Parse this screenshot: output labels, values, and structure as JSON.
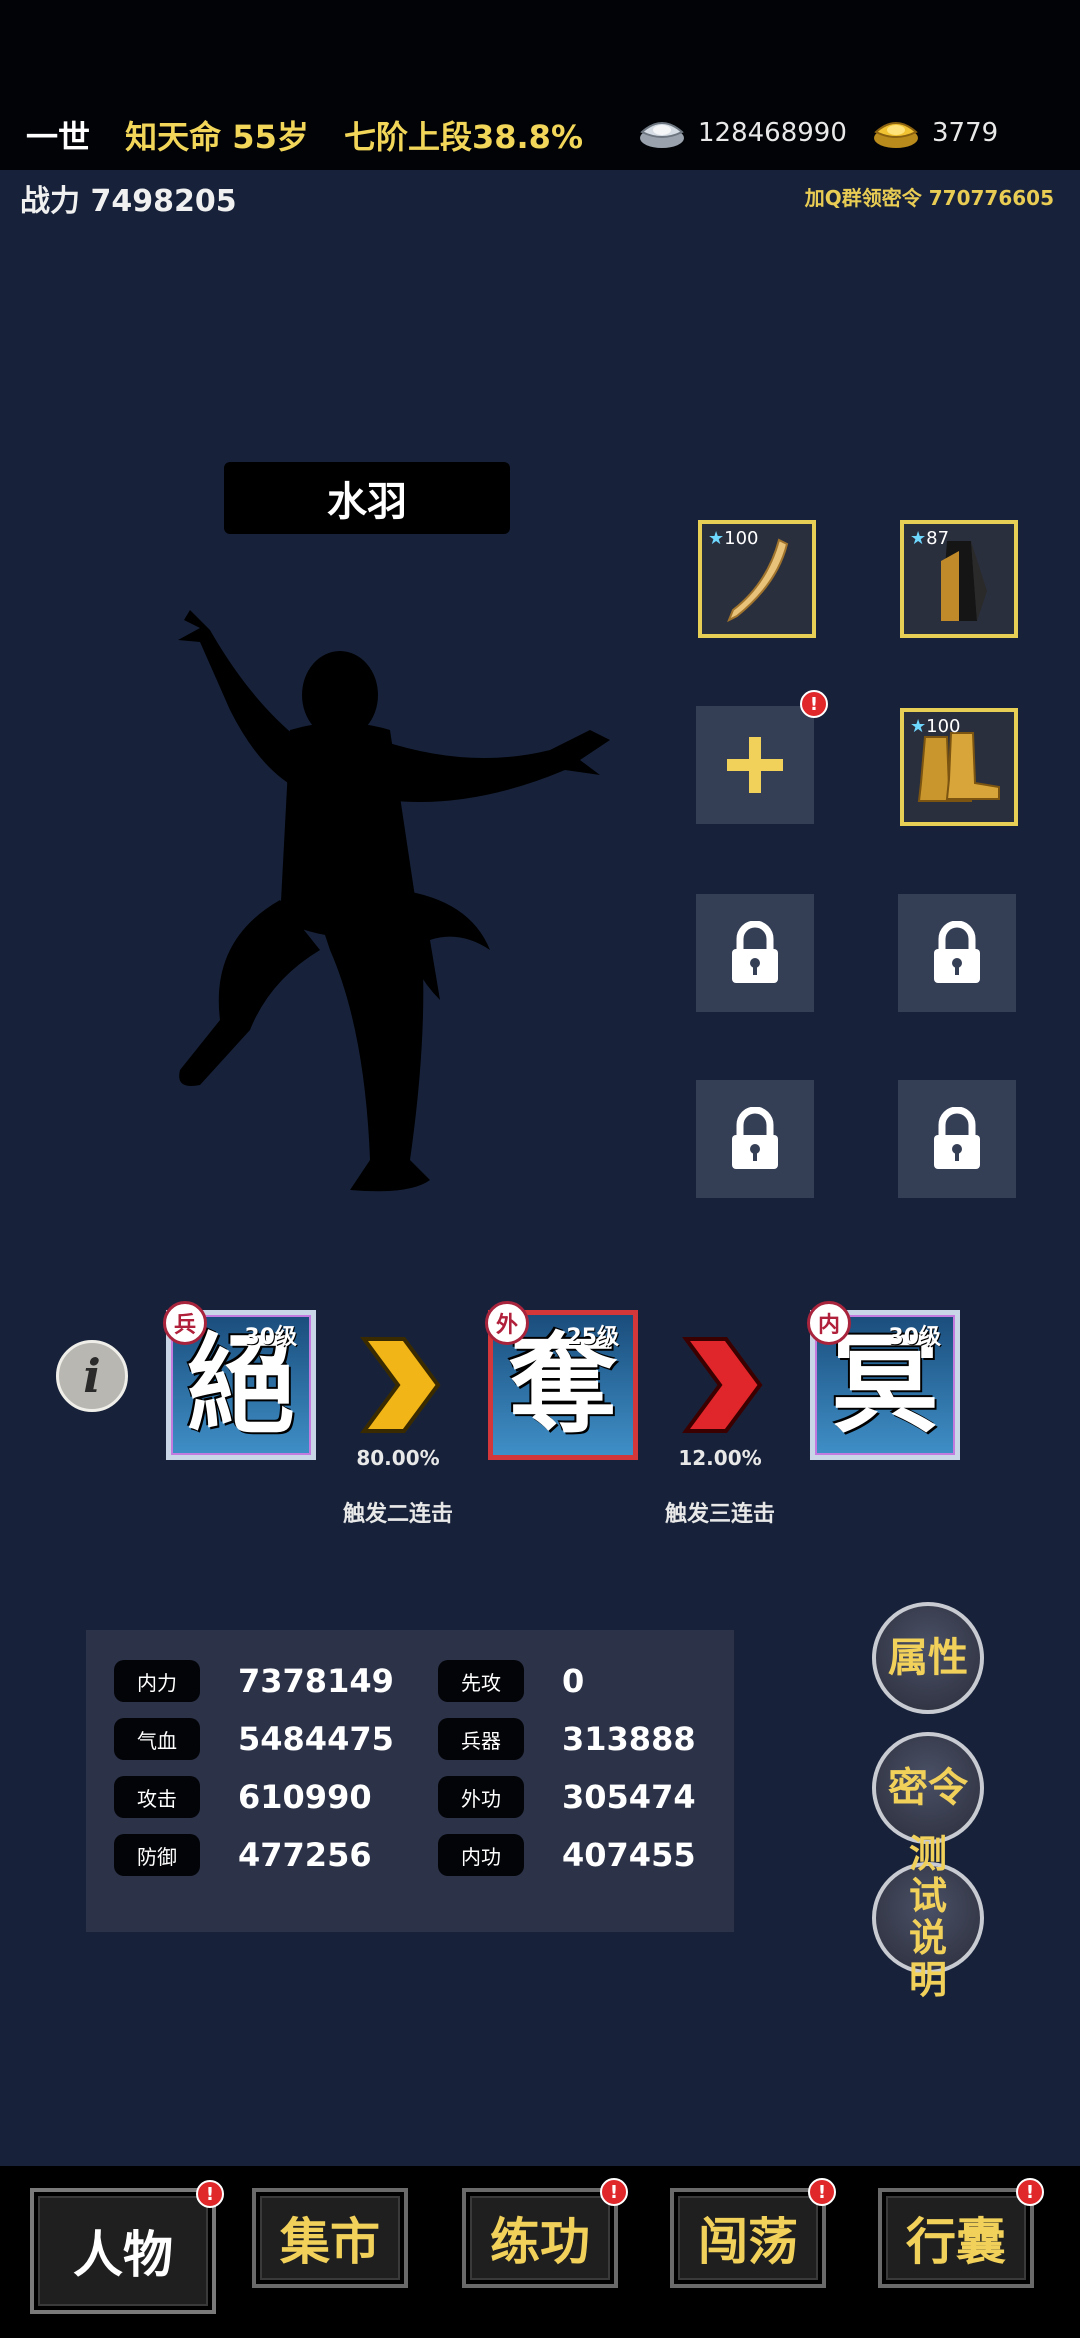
{
  "header": {
    "generation": "一世",
    "age": "知天命 55岁",
    "stage": "七阶上段38.8%",
    "silver": "128468990",
    "gold": "3779",
    "power": "战力 7498205",
    "promo": "加Q群领密令 770776605"
  },
  "character": {
    "name": "水羽"
  },
  "equipment": [
    {
      "name": "weapon-blade",
      "stars": "100"
    },
    {
      "name": "armor-robe",
      "stars": "87"
    },
    {
      "name": "add-slot"
    },
    {
      "name": "boots",
      "stars": "100"
    }
  ],
  "skills": [
    {
      "type": "兵",
      "level": "30级",
      "glyph": "絕"
    },
    {
      "type": "外",
      "level": "25级",
      "glyph": "奪"
    },
    {
      "type": "内",
      "level": "30级",
      "glyph": "冥"
    }
  ],
  "combos": [
    {
      "rate": "80.00%",
      "label": "触发二连击",
      "color": "#f1b517"
    },
    {
      "rate": "12.00%",
      "label": "触发三连击",
      "color": "#e0262a"
    }
  ],
  "stats": [
    {
      "label": "内力",
      "value": "7378149"
    },
    {
      "label": "先攻",
      "value": "0"
    },
    {
      "label": "气血",
      "value": "5484475"
    },
    {
      "label": "兵器",
      "value": "313888"
    },
    {
      "label": "攻击",
      "value": "610990"
    },
    {
      "label": "外功",
      "value": "305474"
    },
    {
      "label": "防御",
      "value": "477256"
    },
    {
      "label": "内功",
      "value": "407455"
    }
  ],
  "side_buttons": [
    "属性",
    "密令",
    "测试说明"
  ],
  "nav": [
    {
      "label": "人物",
      "badge": "!"
    },
    {
      "label": "集市"
    },
    {
      "label": "练功",
      "badge": "!"
    },
    {
      "label": "闯荡",
      "badge": "!"
    },
    {
      "label": "行囊",
      "badge": "!"
    }
  ],
  "colors": {
    "accent_gold": "#f2d15b",
    "background": "#17223a",
    "badge_red": "#e0282b"
  }
}
